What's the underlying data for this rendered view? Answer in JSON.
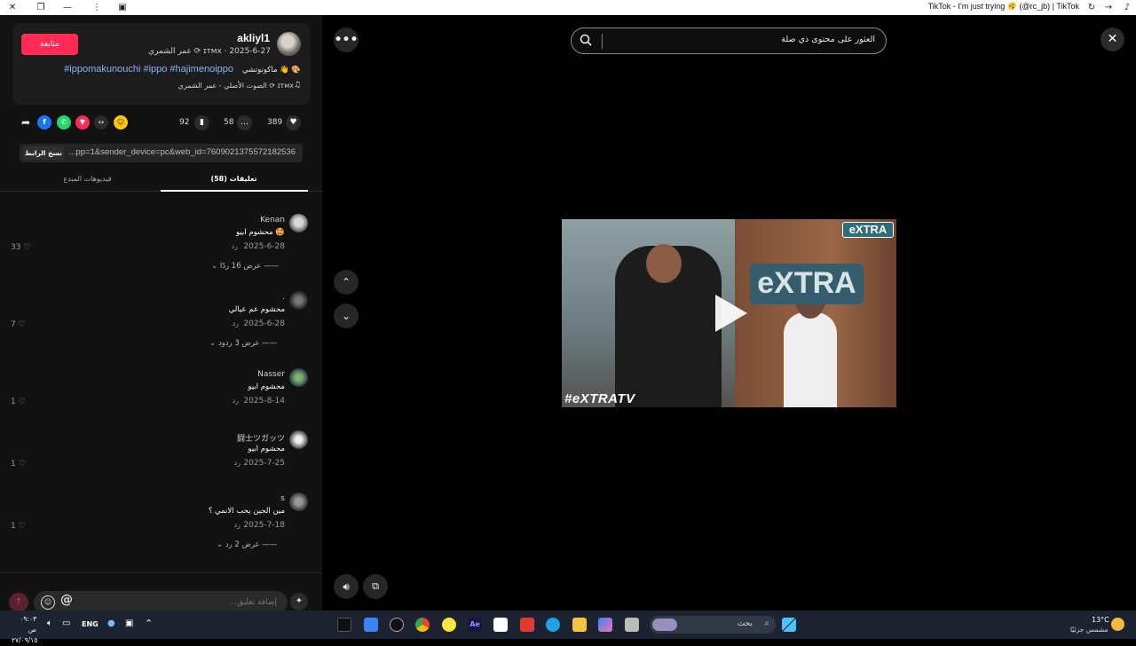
{
  "window": {
    "title": "TikTok - I’m just trying 🫨 (@rc_jb) | TikTok"
  },
  "post": {
    "username": "akliyl1",
    "nickname_date": "عمر الشمري ⟳ ɪтмx · 2025-6-27",
    "follow_label": "متابعة",
    "caption_ar": "ماكونوتشي 👋 🎨",
    "hashtags": "#ippomakunouchi #ippo #hajimenoippo",
    "sound": "الصوت الأصلي - عمر الشمري ⟳ ɪтмx",
    "likes": "389",
    "comments": "58",
    "saves": "92",
    "link": "...pp=1&sender_device=pc&web_id=7609021375572182536",
    "copy_link_label": "نسخ الرابط"
  },
  "tabs": {
    "comments": "تعليقات (58)",
    "creator_videos": "فيديوهات المبدع"
  },
  "comments": [
    {
      "name": "Kenan",
      "text": "محشوم ابيو 🤩",
      "date": "2025-6-28",
      "reply": "رد",
      "likes": "33",
      "view_replies": "عرض 16 ردًا"
    },
    {
      "name": ".",
      "text": "محشوم عم عيالي",
      "date": "2025-6-28",
      "reply": "رد",
      "likes": "7",
      "view_replies": "عرض 3 ردود"
    },
    {
      "name": "Nasser",
      "text": "محشوم ابيو",
      "date": "2025-8-14",
      "reply": "رد",
      "likes": "1",
      "view_replies": ""
    },
    {
      "name": "闘士ツガッツ",
      "text": "محشوم ابيو",
      "date": "2025-7-25",
      "reply": "رد",
      "likes": "1",
      "view_replies": ""
    },
    {
      "name": "s",
      "text": "مين الجين يحب الانمي ؟",
      "date": "2025-7-18",
      "reply": "رد",
      "likes": "1",
      "view_replies": "عرض 2 رد"
    }
  ],
  "comment_input": {
    "placeholder": "إضافة تعليق..."
  },
  "search": {
    "placeholder": "العثور على محتوى ذي صلة"
  },
  "video": {
    "watermark_bottom": "#eXTRATV",
    "watermark_corner": "eXTRA",
    "wall_text": "eXTRA"
  },
  "taskbar": {
    "time": "٠٩:٠٣ ص",
    "date": "٢٧/٠٩/١٥",
    "lang": "ENG",
    "search_label": "بحث",
    "weather_temp": "13°C",
    "weather_desc": "مشمس جزئيًا"
  },
  "icons": {
    "like": "heart-icon",
    "comment": "comment-icon",
    "save": "bookmark-icon",
    "share": "share-icon"
  }
}
